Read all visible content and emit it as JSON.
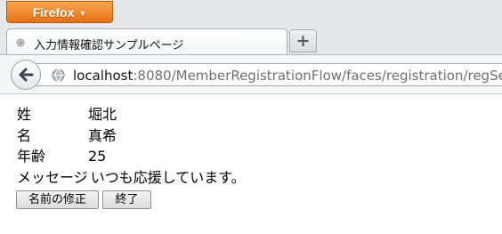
{
  "browser": {
    "menu_button_label": "Firefox",
    "menu_button_arrow": "▼",
    "tab": {
      "title": "入力情報確認サンプルページ",
      "icon": "page-icon"
    },
    "new_tab_label": "+",
    "url": {
      "host": "localhost",
      "path": ":8080/MemberRegistrationFlow/faces/registration/regSe"
    }
  },
  "page": {
    "fields": [
      {
        "label": "姓",
        "value": "堀北"
      },
      {
        "label": "名",
        "value": "真希"
      },
      {
        "label": "年齢",
        "value": "25"
      },
      {
        "label": "メッセージ",
        "value": "いつも応援しています。"
      }
    ],
    "buttons": {
      "edit_name": "名前の修正",
      "end": "終了"
    }
  }
}
